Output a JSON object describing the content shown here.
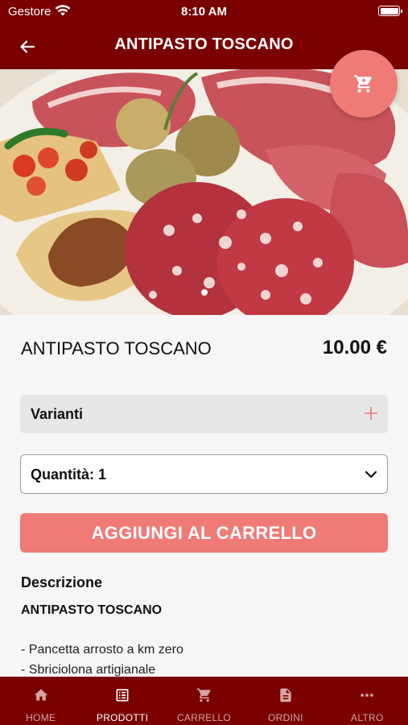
{
  "status_bar": {
    "carrier": "Gestore",
    "time": "8:10 AM",
    "battery_level": 1.0
  },
  "nav": {
    "title": "ANTIPASTO TOSCANO"
  },
  "hero": {
    "pages": 1,
    "current_page": 1
  },
  "product": {
    "name": "ANTIPASTO TOSCANO",
    "price": "10.00 €"
  },
  "variants": {
    "label": "Varianti"
  },
  "quantity": {
    "label": "Quantità: 1"
  },
  "add_to_cart": {
    "label": "AGGIUNGI AL CARRELLO"
  },
  "description": {
    "heading": "Descrizione",
    "title": "ANTIPASTO TOSCANO",
    "lines": [
      "- Pancetta arrosto a km zero",
      "- Sbriciolona artigianale"
    ]
  },
  "tabs": [
    {
      "label": "HOME",
      "icon": "home-icon"
    },
    {
      "label": "PRODOTTI",
      "icon": "list-icon",
      "active": true
    },
    {
      "label": "CARRELLO",
      "icon": "cart-icon"
    },
    {
      "label": "ORDINI",
      "icon": "document-icon"
    },
    {
      "label": "ALTRO",
      "icon": "more-icon"
    }
  ],
  "colors": {
    "brand": "#7a0000",
    "accent": "#ef7a76",
    "background": "#f6f6f6"
  }
}
